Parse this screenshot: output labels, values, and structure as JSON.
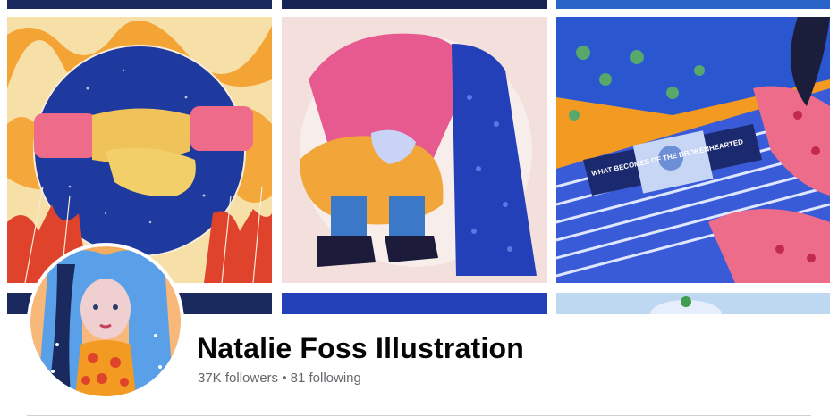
{
  "profile": {
    "name": "Natalie Foss Illustration",
    "followers": "37K followers",
    "separator": " • ",
    "following": "81 following"
  },
  "cover": {
    "artwork_1_icon": "illustration-handshake-icon",
    "artwork_2_icon": "illustration-crouching-figure-icon",
    "artwork_3_icon": "illustration-records-icon",
    "artwork_3_caption": "WHAT BECOMES OF THE BROKENHEARTED"
  },
  "colors": {
    "dark_navy": "#1b2a5e",
    "royal_blue": "#2440b8",
    "orange": "#f29a21",
    "pink": "#e65a8f",
    "cream": "#f6ecd8",
    "text_primary": "#050505",
    "text_secondary": "#65676b"
  }
}
